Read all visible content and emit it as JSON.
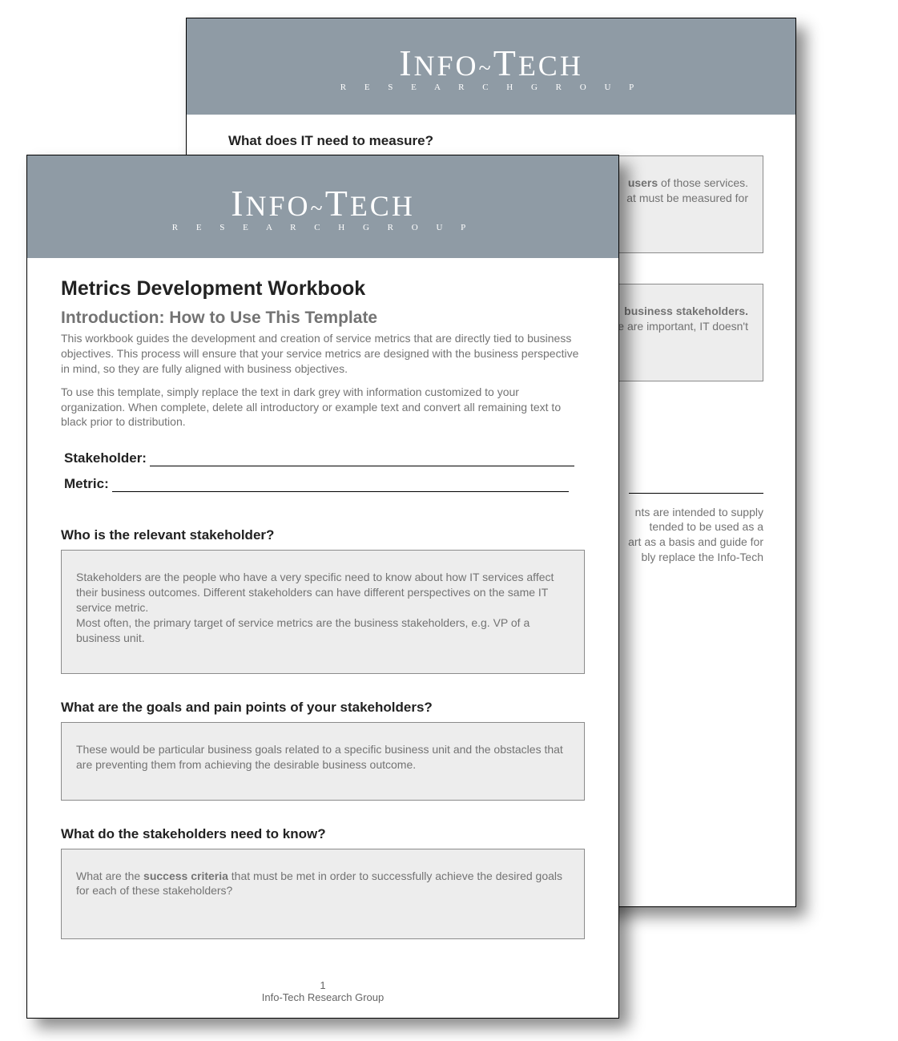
{
  "logo": {
    "mainA": "I",
    "mainB": "NFO",
    "mainC": "T",
    "mainD": "ECH",
    "tilde": "~",
    "sub": "R E S E A R C H   G R O U P"
  },
  "page2": {
    "q1_heading": "What does IT need to measure?",
    "q1_box_frag1": "users",
    "q1_box_frag2": " of those services.",
    "q1_box_frag3": "at must be measured for",
    "q2_box_frag1": " business stakeholders.",
    "q2_box_frag2": "e are important, IT doesn't",
    "disclaimer1": "nts are intended to supply",
    "disclaimer2": "tended to be used as a",
    "disclaimer3": "art as a basis and guide for",
    "disclaimer4": "bly replace the Info-Tech"
  },
  "page1": {
    "title": "Metrics Development Workbook",
    "subtitle": "Introduction: How to Use This Template",
    "intro1": "This workbook guides the development and creation of service metrics that are directly tied to business objectives. This process will ensure that your service metrics are designed with the business perspective in mind, so they are fully aligned with business objectives.",
    "intro2": "To use this template, simply replace the text in dark grey with information customized to your organization. When complete, delete all introductory or example text and convert all remaining text to black prior to distribution.",
    "field_stakeholder": "Stakeholder:",
    "field_metric": "Metric:",
    "section1": {
      "heading": "Who is the relevant stakeholder?",
      "box_p1": "Stakeholders are the people who have a very specific need to know about how IT services affect their business outcomes. Different stakeholders can have different perspectives on the same IT service metric.",
      "box_p2": "Most often, the primary target of service metrics are the business stakeholders, e.g. VP of a business unit."
    },
    "section2": {
      "heading": "What are the goals and pain points of your stakeholders?",
      "box_p1": "These would be particular business goals related to a specific business unit and the obstacles that are preventing them from achieving the desirable business outcome."
    },
    "section3": {
      "heading": "What do the stakeholders need to know?",
      "box_pre": "What are the ",
      "box_bold": "success criteria",
      "box_post": " that must be met in order to successfully achieve the desired goals for each of these stakeholders?"
    },
    "footer_pagenum": "1",
    "footer_org": "Info-Tech Research Group"
  }
}
